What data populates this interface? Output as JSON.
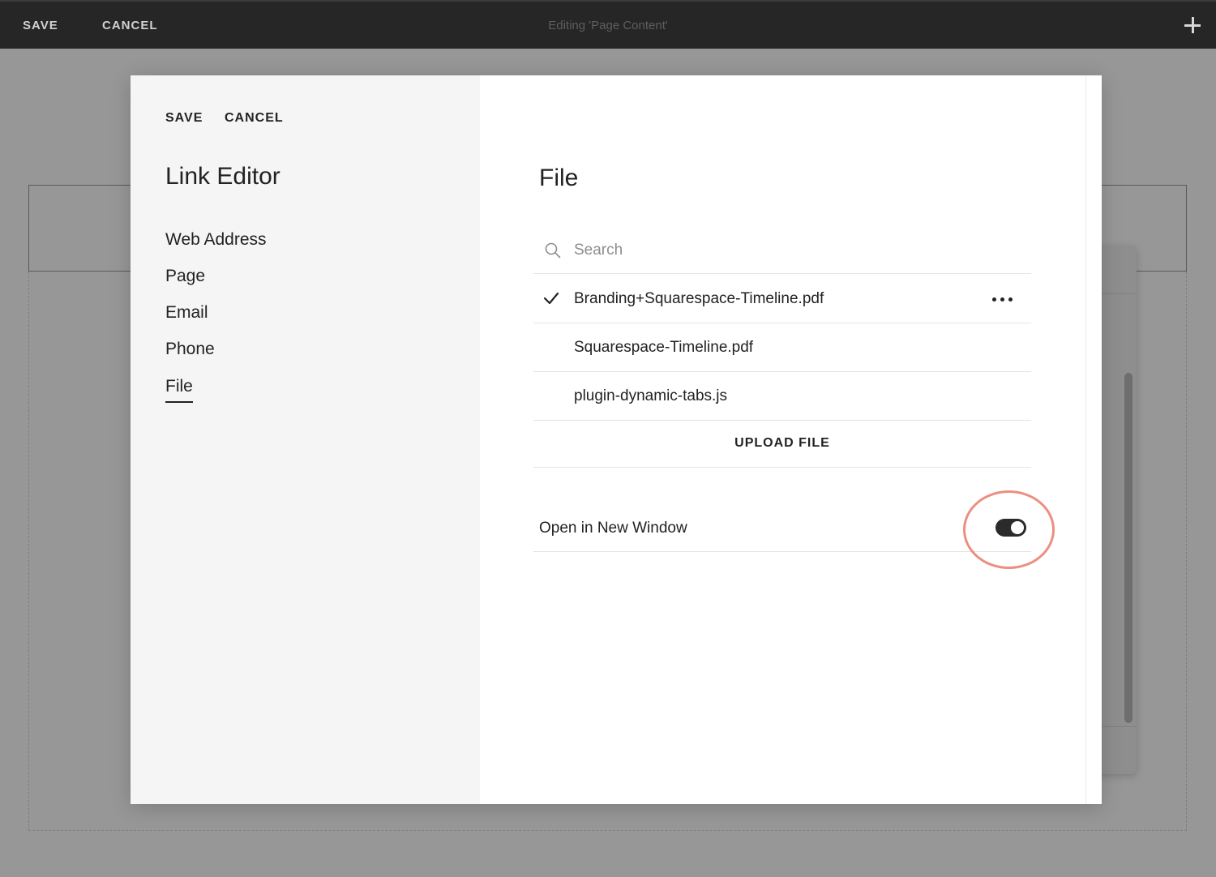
{
  "top_bar": {
    "save_label": "SAVE",
    "cancel_label": "CANCEL",
    "title": "Editing 'Page Content'"
  },
  "link_editor": {
    "save_label": "SAVE",
    "cancel_label": "CANCEL",
    "title": "Link Editor",
    "nav": [
      {
        "label": "Web Address"
      },
      {
        "label": "Page"
      },
      {
        "label": "Email"
      },
      {
        "label": "Phone"
      },
      {
        "label": "File",
        "active": true
      }
    ]
  },
  "file_panel": {
    "title": "File",
    "search": {
      "placeholder": "Search",
      "value": ""
    },
    "files": [
      {
        "name": "Branding+Squarespace-Timeline.pdf",
        "selected": true
      },
      {
        "name": "Squarespace-Timeline.pdf",
        "selected": false
      },
      {
        "name": "plugin-dynamic-tabs.js",
        "selected": false
      }
    ],
    "upload_label": "UPLOAD FILE",
    "open_in_new_window": {
      "label": "Open in New Window",
      "enabled": true
    }
  },
  "colors": {
    "top_bar_bg": "#262626",
    "overlay_bg": "#979797",
    "sidebar_bg": "#f5f5f5",
    "highlight": "#ec8f80"
  },
  "icons": {
    "top_add": "plus-icon",
    "search": "search-icon",
    "selected_file": "checkmark-icon",
    "file_options": "more-horizontal-icon"
  }
}
